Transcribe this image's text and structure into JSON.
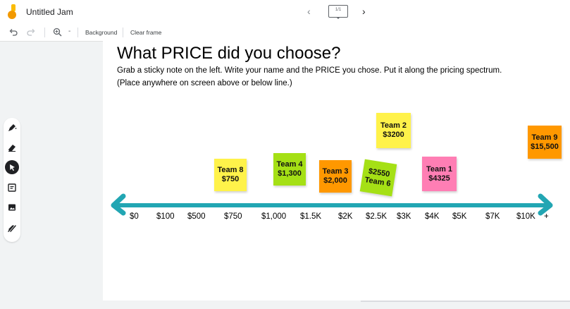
{
  "app": {
    "title": "Untitled Jam",
    "frame_indicator": "1/1"
  },
  "toolbar": {
    "background_label": "Background",
    "clear_frame_label": "Clear frame",
    "zoom_minus": "-"
  },
  "canvas": {
    "heading": "What PRICE did you choose?",
    "line1": "Grab a sticky note on the left. Write your name and the PRICE you chose. Put it along the pricing spectrum.",
    "line2": "(Place anywhere on screen above or below line.)"
  },
  "notes": [
    {
      "text": "Team 8\n$750",
      "color": "#fff24a"
    },
    {
      "text": "Team 4\n$1,300",
      "color": "#a5e015"
    },
    {
      "text": "Team 3\n$2,000",
      "color": "#ff9800"
    },
    {
      "text": "$2550\nTeam 6",
      "color": "#a5e015"
    },
    {
      "text": "Team 2\n$3200",
      "color": "#fff24a"
    },
    {
      "text": "Team 1\n$4325",
      "color": "#ff7eb4"
    },
    {
      "text": "Team 9\n$15,500",
      "color": "#ff9800"
    }
  ],
  "spectrum": {
    "color": "#22a6b3",
    "ticks": [
      "$0",
      "$100",
      "$500",
      "$750",
      "$1,000",
      "$1.5K",
      "$2K",
      "$2.5K",
      "$3K",
      "$4K",
      "$5K",
      "$7K",
      "$10K",
      "+"
    ]
  },
  "icons": {
    "logo": "jamboard-logo",
    "tools": [
      "pen-icon",
      "eraser-icon",
      "select-icon",
      "sticky-note-icon",
      "image-icon",
      "laser-icon"
    ]
  }
}
